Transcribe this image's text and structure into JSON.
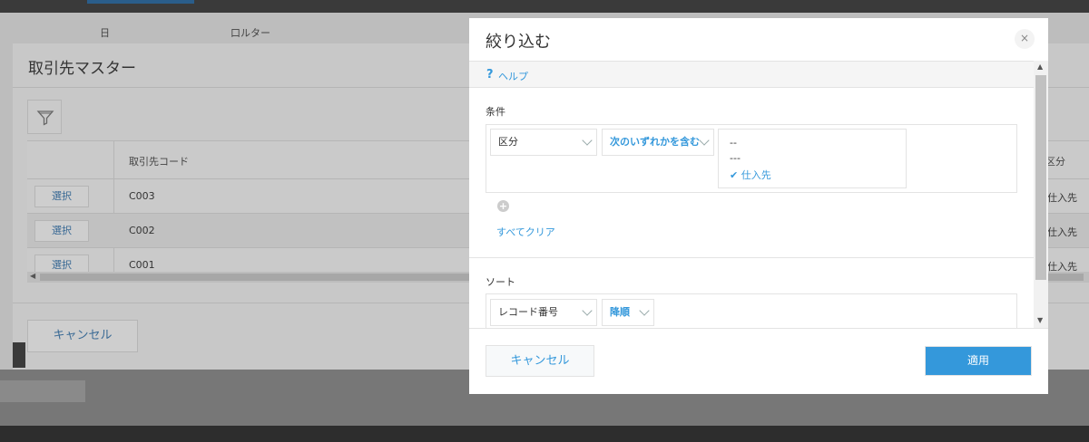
{
  "background": {
    "form_labels": [
      "日",
      "口ルター"
    ],
    "master_title": "取引先マスター",
    "table": {
      "headers": {
        "code": "取引先コード",
        "kubun": "区分"
      },
      "rows": [
        {
          "select": "選択",
          "code": "C003",
          "kubun": "仕入先"
        },
        {
          "select": "選択",
          "code": "C002",
          "kubun": "仕入先"
        },
        {
          "select": "選択",
          "code": "C001",
          "kubun": "仕入先"
        }
      ]
    },
    "cancel_label": "キャンセル"
  },
  "modal": {
    "title": "絞り込む",
    "close_icon": "×",
    "help": {
      "icon": "?",
      "label": "ヘルプ"
    },
    "conditions": {
      "label": "条件",
      "field": "区分",
      "operator": "次のいずれかを含む",
      "options": [
        "--",
        "---",
        "仕入先"
      ],
      "checked_option": "仕入先",
      "add_icon": "+",
      "clear_all": "すべてクリア"
    },
    "sort": {
      "label": "ソート",
      "field": "レコード番号",
      "order": "降順"
    },
    "footer": {
      "cancel": "キャンセル",
      "apply": "適用"
    }
  },
  "colors": {
    "accent": "#3498db",
    "overlay": "#c8c8c8"
  }
}
